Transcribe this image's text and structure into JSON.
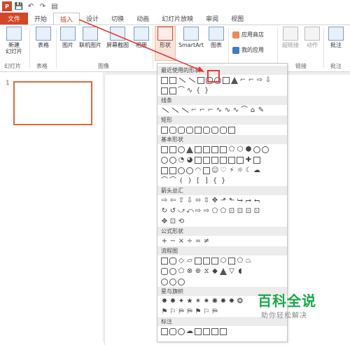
{
  "quick_access": {
    "app_badge": "P"
  },
  "tabs": [
    "文件",
    "开始",
    "插入",
    "设计",
    "切换",
    "动画",
    "幻灯片放映",
    "审阅",
    "视图"
  ],
  "ribbon": {
    "new_slide": "新建\n幻灯片",
    "table": "表格",
    "picture": "图片",
    "online_picture": "联机图片",
    "screenshot": "屏幕截图",
    "album": "相册",
    "shape": "形状",
    "smartart": "SmartArt",
    "chart": "图表",
    "app_store": "应用商店",
    "my_apps": "我的应用",
    "hyperlink": "超链接",
    "action": "动作",
    "comment": "批注",
    "groups": {
      "slides": "幻灯片",
      "tables": "表格",
      "images": "图像",
      "links": "链接",
      "comments": "批注"
    }
  },
  "slide_panel": {
    "slide_number": "1"
  },
  "shape_dropdown": {
    "sections": [
      "最近使用的形状",
      "线条",
      "矩形",
      "基本形状",
      "箭头总汇",
      "公式形状",
      "流程图",
      "星与旗帜",
      "标注"
    ]
  },
  "watermark": {
    "title": "百科全说",
    "subtitle": "助你轻松解决"
  }
}
